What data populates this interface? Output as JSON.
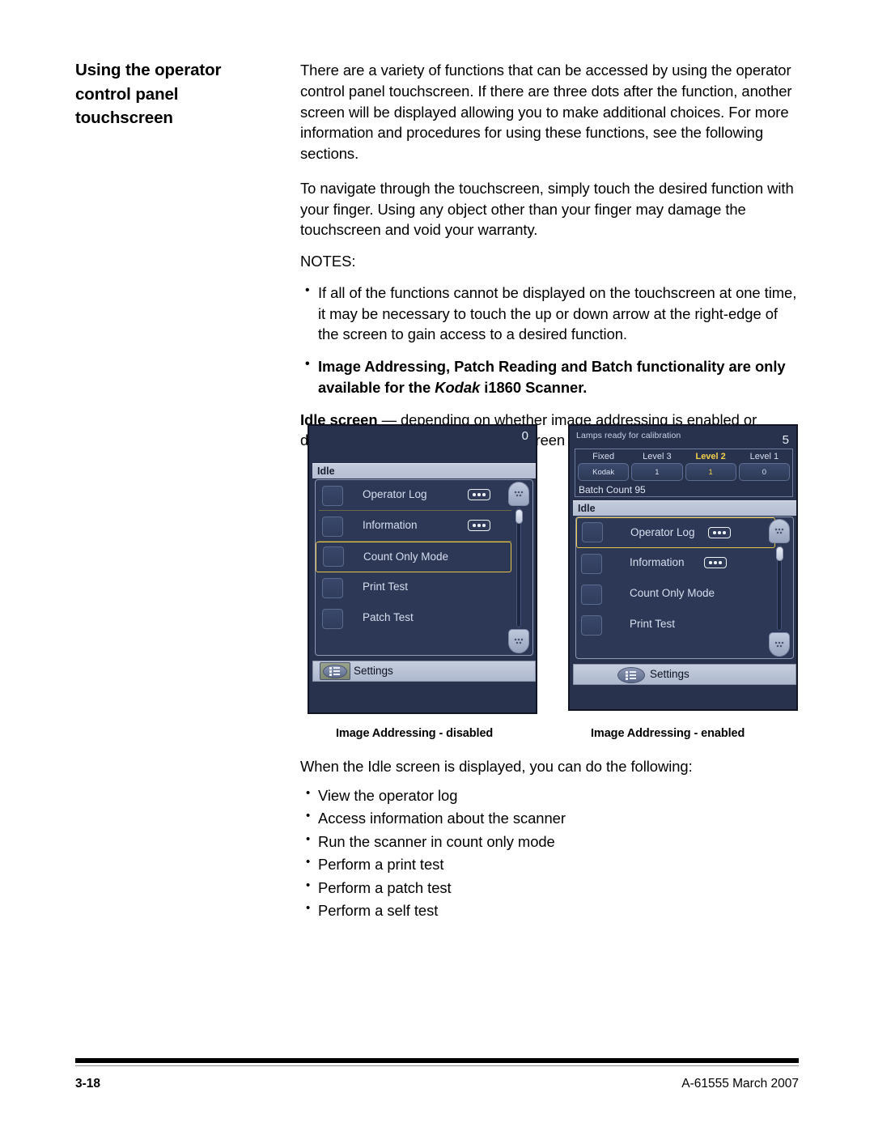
{
  "heading": {
    "line1": "Using the operator",
    "line2": "control panel",
    "line3": "touchscreen"
  },
  "body": {
    "para1": "There are a variety of functions that can be accessed by using the operator control panel touchscreen. If there are three dots after the function, another screen will be displayed allowing you to make additional choices. For more information and procedures for using these functions, see the following sections.",
    "para2": "To navigate through the touchscreen, simply touch the desired function with your finger. Using any object other than your finger may damage the touchscreen and void your warranty.",
    "notes_label": "NOTES:",
    "note1": "If all of the functions cannot be displayed on the touchscreen at one time, it may be necessary to touch the up or down arrow at the right-edge of the screen to gain access to a desired function.",
    "note2_pre": "Image Addressing, Patch Reading and Batch functionality are only available for the ",
    "note2_italic": "Kodak",
    "note2_post": " i1860 Scanner.",
    "idle_bold": "Idle screen",
    "idle_rest": " — depending on whether image addressing is enabled or disabled or not available, the Idle screen will appear differently."
  },
  "figure": {
    "caption_left": "Image Addressing - disabled",
    "caption_right": "Image Addressing - enabled",
    "screen_disabled": {
      "status_text": "",
      "counter": "0",
      "idle_title": "Idle",
      "rows": [
        {
          "label": "Operator Log",
          "has_dots": true,
          "selected": false
        },
        {
          "label": "Information",
          "has_dots": true,
          "selected": false
        },
        {
          "label": "Count Only Mode",
          "has_dots": false,
          "selected": true
        },
        {
          "label": "Print Test",
          "has_dots": false,
          "selected": false
        },
        {
          "label": "Patch Test",
          "has_dots": false,
          "selected": false
        }
      ],
      "settings_label": "Settings"
    },
    "screen_enabled": {
      "status_text": "Lamps ready for calibration",
      "counter": "5",
      "address_fields": [
        {
          "header": "Fixed",
          "value": "Kodak",
          "highlighted": false
        },
        {
          "header": "Level 3",
          "value": "1",
          "highlighted": false
        },
        {
          "header": "Level 2",
          "value": "1",
          "highlighted": true
        },
        {
          "header": "Level 1",
          "value": "0",
          "highlighted": false
        }
      ],
      "batch_count": "Batch Count 95",
      "idle_title": "Idle",
      "rows": [
        {
          "label": "Operator Log",
          "has_dots": true,
          "selected": true
        },
        {
          "label": "Information",
          "has_dots": true,
          "selected": false
        },
        {
          "label": "Count Only Mode",
          "has_dots": false,
          "selected": false
        },
        {
          "label": "Print Test",
          "has_dots": false,
          "selected": false
        }
      ],
      "settings_label": "Settings"
    }
  },
  "bottom": {
    "intro": "When the Idle screen is displayed, you can do the following:",
    "items": [
      "View the operator log",
      "Access information about the scanner",
      "Run the scanner in count only mode",
      "Perform a print test",
      "Perform a patch test",
      "Perform a self test"
    ]
  },
  "footer": {
    "page_number": "3-18",
    "doc_id": "A-61555 March 2007"
  },
  "colors": {
    "screen_background": "#28324d",
    "highlight_yellow": "#e8c64a",
    "idle_bar": "#b9c2d6",
    "text_light": "#d7deee"
  }
}
